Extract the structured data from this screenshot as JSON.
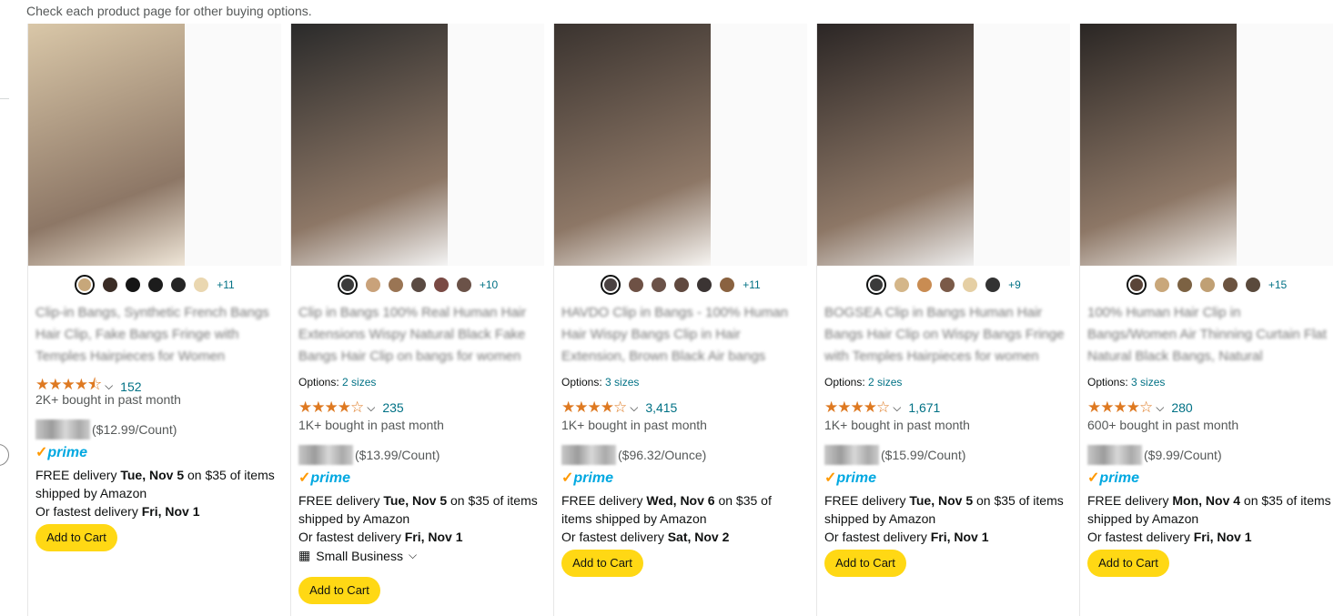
{
  "top_note": "Check each product page for other buying options.",
  "products": [
    {
      "title": "Clip-in Bangs, Synthetic French Bangs Hair Clip, Fake Bangs Fringe with Temples Hairpieces for Women",
      "options": null,
      "more_colors": "+11",
      "swatches": [
        "#c7a77a",
        "#3a2c25",
        "#151515",
        "#1c1c1c",
        "#252525",
        "#ead7b0"
      ],
      "stars": "★★★★⯪",
      "rating_count": "152",
      "bought": "2K+ bought in past month",
      "unit_price": "($12.99/Count)",
      "prime_text": "prime",
      "delivery_prefix": "FREE delivery ",
      "delivery_date": "Tue, Nov 5",
      "delivery_suffix": " on $35 of items shipped by Amazon",
      "fastest_prefix": "Or fastest delivery ",
      "fastest_date": "Fri, Nov 1",
      "small_business": null,
      "add_to_cart": "Add to Cart"
    },
    {
      "title": "Clip in Bangs 100% Real Human Hair Extensions Wispy Natural Black Fake Bangs Hair Clip on bangs for women",
      "options_label": "Options:",
      "options_value": "2 sizes",
      "more_colors": "+10",
      "swatches": [
        "#3b3b3b",
        "#c9a27a",
        "#9a7554",
        "#5a4a42",
        "#7a4a44",
        "#6b5248"
      ],
      "stars": "★★★★☆",
      "rating_count": "235",
      "bought": "1K+ bought in past month",
      "unit_price": "($13.99/Count)",
      "prime_text": "prime",
      "delivery_prefix": "FREE delivery ",
      "delivery_date": "Tue, Nov 5",
      "delivery_suffix": " on $35 of items shipped by Amazon",
      "fastest_prefix": "Or fastest delivery ",
      "fastest_date": "Fri, Nov 1",
      "small_business": "Small Business",
      "add_to_cart": "Add to Cart"
    },
    {
      "title": "HAVDO Clip in Bangs - 100% Human Hair Wispy Bangs Clip in Hair Extension, Brown Black Air bangs",
      "options_label": "Options:",
      "options_value": "3 sizes",
      "more_colors": "+11",
      "swatches": [
        "#4a4242",
        "#6e5145",
        "#6b5248",
        "#60493f",
        "#3b3433",
        "#8a6240"
      ],
      "stars": "★★★★☆",
      "rating_count": "3,415",
      "bought": "1K+ bought in past month",
      "unit_price": "($96.32/Ounce)",
      "prime_text": "prime",
      "delivery_prefix": "FREE delivery ",
      "delivery_date": "Wed, Nov 6",
      "delivery_suffix": " on $35 of items shipped by Amazon",
      "fastest_prefix": "Or fastest delivery ",
      "fastest_date": "Sat, Nov 2",
      "small_business": null,
      "add_to_cart": "Add to Cart"
    },
    {
      "title": "BOGSEA Clip in Bangs Human Hair Bangs Hair Clip on Wispy Bangs Fringe with Temples Hairpieces for women",
      "options_label": "Options:",
      "options_value": "2 sizes",
      "more_colors": "+9",
      "swatches": [
        "#3a3a3a",
        "#d4b689",
        "#c98c52",
        "#7a5a48",
        "#e5cfa4",
        "#333"
      ],
      "stars": "★★★★☆",
      "rating_count": "1,671",
      "bought": "1K+ bought in past month",
      "unit_price": "($15.99/Count)",
      "prime_text": "prime",
      "delivery_prefix": "FREE delivery ",
      "delivery_date": "Tue, Nov 5",
      "delivery_suffix": " on $35 of items shipped by Amazon",
      "fastest_prefix": "Or fastest delivery ",
      "fastest_date": "Fri, Nov 1",
      "small_business": null,
      "add_to_cart": "Add to Cart"
    },
    {
      "title": "100% Human Hair Clip in Bangs/Women Air Thinning Curtain Flat Natural Black Bangs, Natural",
      "options_label": "Options:",
      "options_value": "3 sizes",
      "more_colors": "+15",
      "swatches": [
        "#5a4438",
        "#c9a77a",
        "#7c6243",
        "#c0a074",
        "#6b5340",
        "#5a4a3c"
      ],
      "stars": "★★★★☆",
      "rating_count": "280",
      "bought": "600+ bought in past month",
      "unit_price": "($9.99/Count)",
      "prime_text": "prime",
      "delivery_prefix": "FREE delivery ",
      "delivery_date": "Mon, Nov 4",
      "delivery_suffix": " on $35 of items shipped by Amazon",
      "fastest_prefix": "Or fastest delivery ",
      "fastest_date": "Fri, Nov 1",
      "small_business": null,
      "add_to_cart": "Add to Cart"
    }
  ]
}
